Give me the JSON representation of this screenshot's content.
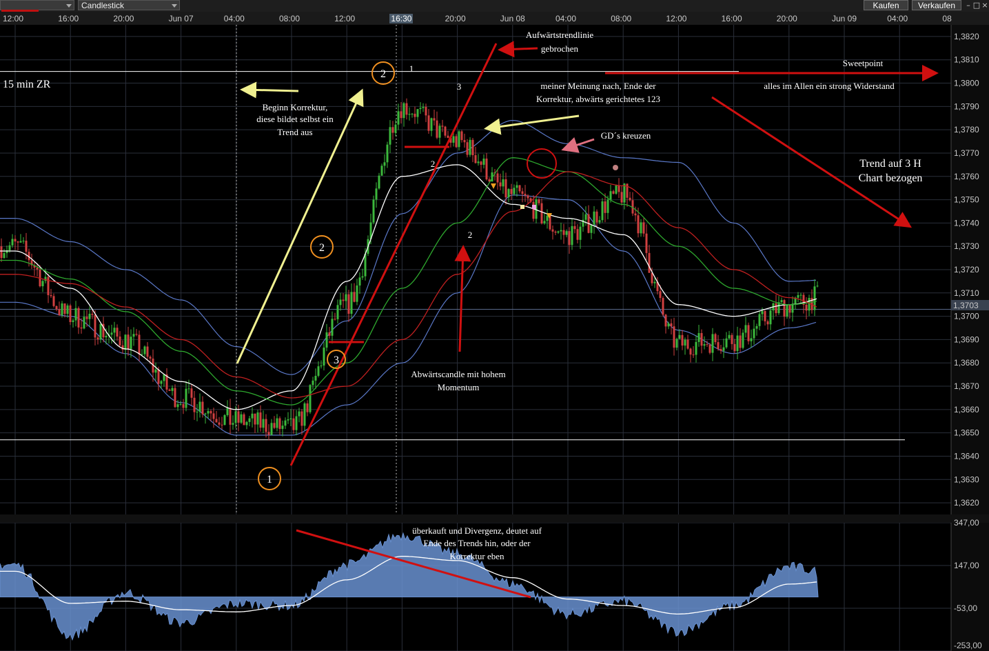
{
  "toolbar": {
    "symbol_value": "",
    "chart_type": "Candlestick",
    "buy_label": "Kaufen",
    "sell_label": "Verkaufen",
    "window_controls": [
      "–",
      "□",
      "×"
    ]
  },
  "time_axis": {
    "labels": [
      "12:00",
      "16:00",
      "20:00",
      "Jun 07",
      "04:00",
      "08:00",
      "12:00",
      "16:30",
      "20:00",
      "Jun 08",
      "04:00",
      "08:00",
      "12:00",
      "16:00",
      "20:00",
      "Jun 09",
      "04:00",
      "08"
    ],
    "highlighted": "16:30"
  },
  "price_axis": {
    "labels": [
      "1,3820",
      "1,3810",
      "1,3800",
      "1,3790",
      "1,3780",
      "1,3770",
      "1,3760",
      "1,3750",
      "1,3740",
      "1,3730",
      "1,3720",
      "1,3710",
      "1,3700",
      "1,3690",
      "1,3680",
      "1,3670",
      "1,3660",
      "1,3650",
      "1,3640",
      "1,3630",
      "1,3620"
    ],
    "current_price": "1,3703"
  },
  "oscillator_axis": {
    "labels": [
      "347,00",
      "147,00",
      "-53,00",
      "-253,00"
    ]
  },
  "annotations": {
    "timeframe": "15 min ZR",
    "trendline_broken": [
      "Aufwärtstrendlinie",
      "gebrochen"
    ],
    "correction_begin": [
      "Beginn Korrektur,",
      "diese bildet selbst ein",
      "Trend aus"
    ],
    "sweetpoint": "Sweetpoint",
    "strong_resistance": "alles im Allen ein strong Widerstand",
    "correction_end": [
      "meiner Meinung nach, Ende der",
      "Korrektur, abwärts gerichtetes 123"
    ],
    "ma_cross": "GD´s kreuzen",
    "trend_3h": [
      "Trend auf 3 H",
      "Chart bezogen"
    ],
    "momentum_candle": [
      "Abwärtscandle mit hohem",
      "Momentum"
    ],
    "overbought": [
      "überkauft und Divergenz, deutet auf",
      "Ende des Trends hin, oder der",
      "Korrektur eben"
    ],
    "circled_points": [
      "1",
      "2",
      "3",
      "2"
    ],
    "plain_points": [
      "1",
      "3",
      "2",
      "2"
    ]
  },
  "colors": {
    "background": "#000000",
    "grid": "#2a2f3a",
    "bollinger": "#5a78c8",
    "ma_fast": "#ffffff",
    "ma_mid": "#2ea82e",
    "ma_slow": "#c02020",
    "bull_candle": "#3cb83c",
    "bear_candle": "#d04040",
    "annotation_red": "#d01010",
    "annotation_yellow": "#f0f090",
    "circle_orange": "#f09020",
    "oscillator_fill": "#6890d0"
  },
  "chart_data": [
    {
      "type": "candlestick",
      "title": "",
      "xlabel": "",
      "ylabel": "",
      "x": [
        "Jun 06 12:00",
        "Jun 06 16:00",
        "Jun 06 20:00",
        "Jun 07 00:00",
        "Jun 07 04:00",
        "Jun 07 08:00",
        "Jun 07 12:00",
        "Jun 07 16:00",
        "Jun 07 20:00",
        "Jun 08 00:00",
        "Jun 08 04:00",
        "Jun 08 08:00",
        "Jun 08 12:00",
        "Jun 08 16:00",
        "Jun 08 20:00",
        "Jun 09 00:00"
      ],
      "series": [
        {
          "values": [
            1.373,
            1.37,
            1.369,
            1.3665,
            1.3655,
            1.3652,
            1.3705,
            1.379,
            1.3775,
            1.3752,
            1.3735,
            1.3752,
            1.3688,
            1.369,
            1.3705,
            1.3712
          ]
        },
        {
          "values": [
            1.3728,
            1.3712,
            1.3686,
            1.3672,
            1.366,
            1.3668,
            1.3715,
            1.376,
            1.3765,
            1.3748,
            1.3742,
            1.3735,
            1.3705,
            1.37,
            1.3705,
            1.371
          ]
        },
        {
          "values": [
            1.3724,
            1.3716,
            1.3702,
            1.3685,
            1.3668,
            1.3662,
            1.368,
            1.3712,
            1.374,
            1.3768,
            1.3762,
            1.3748,
            1.373,
            1.3712,
            1.3705,
            1.3708
          ]
        },
        {
          "values": [
            1.3718,
            1.3714,
            1.3704,
            1.369,
            1.3674,
            1.3665,
            1.367,
            1.369,
            1.3718,
            1.3745,
            1.3762,
            1.3756,
            1.3738,
            1.372,
            1.3708,
            1.37
          ]
        }
      ],
      "ylim": [
        1.3615,
        1.3825
      ],
      "price_levels": [
        1.3805,
        1.3647,
        1.3703
      ],
      "grid": true,
      "legend": "none"
    },
    {
      "type": "area",
      "title": "",
      "x": [
        "Jun 06 12:00",
        "Jun 06 16:00",
        "Jun 06 20:00",
        "Jun 07 00:00",
        "Jun 07 04:00",
        "Jun 07 08:00",
        "Jun 07 12:00",
        "Jun 07 16:00",
        "Jun 07 20:00",
        "Jun 08 00:00",
        "Jun 08 04:00",
        "Jun 08 08:00",
        "Jun 08 12:00",
        "Jun 08 16:00",
        "Jun 08 20:00",
        "Jun 09 00:00"
      ],
      "series": [
        {
          "values": [
            150,
            -180,
            20,
            -120,
            -30,
            -40,
            150,
            290,
            200,
            60,
            -80,
            -20,
            -160,
            -40,
            140,
            90
          ]
        },
        {
          "values": [
            120,
            -30,
            -20,
            -60,
            -70,
            -40,
            80,
            190,
            170,
            90,
            -10,
            -40,
            -80,
            -50,
            60,
            80
          ]
        }
      ],
      "ylim": [
        -253,
        347
      ],
      "grid": true,
      "legend": "none"
    }
  ]
}
